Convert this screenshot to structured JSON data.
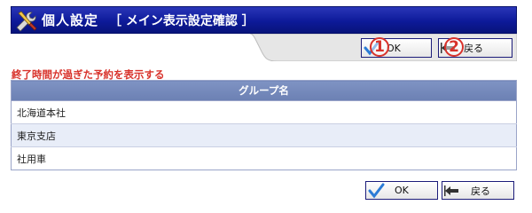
{
  "header": {
    "title": "個人設定",
    "subtitle": "［ メイン表示設定確認 ］",
    "icon": "tools-icon"
  },
  "toolbar": {
    "ok_label": "OK",
    "back_label": "戻る",
    "ok_marker": "1",
    "back_marker": "2"
  },
  "notice": "終了時間が過ぎた予約を表示する",
  "table": {
    "header": "グループ名",
    "rows": [
      "北海道本社",
      "東京支店",
      "社用車"
    ]
  },
  "footer": {
    "ok_label": "OK",
    "back_label": "戻る"
  },
  "colors": {
    "title_bar": "#0d1a99",
    "table_header": "#7387b9",
    "notice_text": "#d8322b",
    "alt_row": "#e8edf8"
  }
}
